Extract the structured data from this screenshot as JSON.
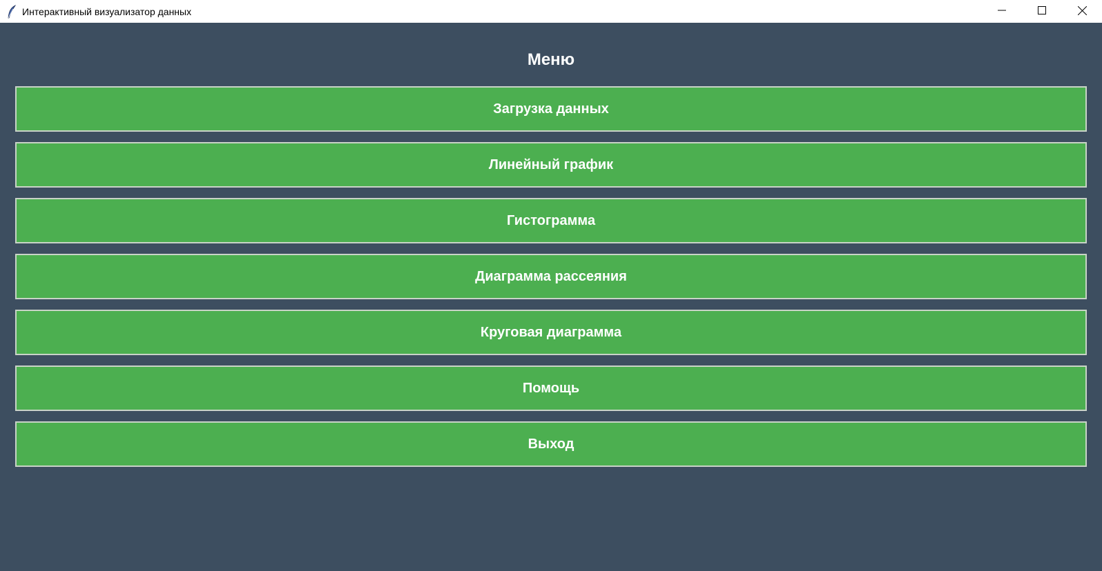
{
  "window": {
    "title": "Интерактивный визуализатор данных",
    "app_icon": "feather-icon",
    "controls": [
      "minimize-icon",
      "maximize-icon",
      "close-icon"
    ]
  },
  "colors": {
    "background": "#3d4e60",
    "button": "#4caf50",
    "button_border": "#c9d3c8",
    "text": "#ffffff"
  },
  "menu": {
    "title": "Меню",
    "items": [
      {
        "label": "Загрузка данных"
      },
      {
        "label": "Линейный график"
      },
      {
        "label": "Гистограмма"
      },
      {
        "label": "Диаграмма рассеяния"
      },
      {
        "label": "Круговая диаграмма"
      },
      {
        "label": "Помощь"
      },
      {
        "label": "Выход"
      }
    ]
  }
}
